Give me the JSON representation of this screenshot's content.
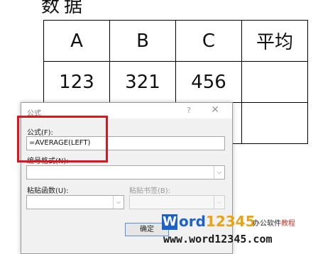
{
  "document": {
    "top_fragment": "数据",
    "table": {
      "rows": [
        [
          "A",
          "B",
          "C",
          "平均"
        ],
        [
          "123",
          "321",
          "456",
          ""
        ],
        [
          "",
          "",
          "",
          ""
        ]
      ]
    }
  },
  "dialog": {
    "title": "公式",
    "help_label": "?",
    "close_label": "✕",
    "formula_label": "公式(F):",
    "formula_value": "=AVERAGE(LEFT)",
    "number_format_label": "编号格式(N):",
    "number_format_value": "",
    "paste_function_label": "粘贴函数(U):",
    "paste_function_value": "",
    "paste_bookmark_label": "粘贴书签(B):",
    "paste_bookmark_value": "",
    "ok_label": "确定"
  },
  "highlight_color": "#e0141e",
  "watermark": {
    "logo_letter": "W",
    "brand_word": "ord",
    "brand_number": "12345",
    "subtitle": "办公软件",
    "subtitle_tag": "教程",
    "url": "www.word12345.com"
  }
}
